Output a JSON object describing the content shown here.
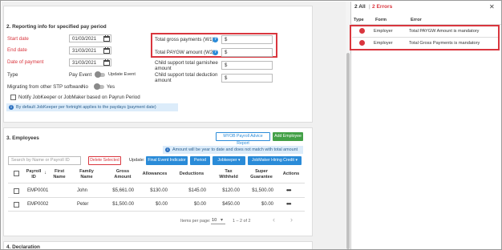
{
  "reporting": {
    "title": "2. Reporting info for specified pay period",
    "start_date_label": "Start date",
    "start_date_value": "01/03/2021",
    "end_date_label": "End date",
    "end_date_value": "31/03/2021",
    "date_of_payment_label": "Date of payment",
    "date_of_payment_value": "31/03/2021",
    "type_label": "Type",
    "type_value": "Pay Event",
    "update_event_label": "Update Event",
    "migrating_label": "Migrating from other STP software",
    "migrating_no": "No",
    "migrating_yes": "Yes",
    "notify_label": "Notify JobKeeper or JobMaker based on Payrun Period",
    "info_text": "By default JobKeeper per fortnight applies to the paydays (payment date)",
    "gross_label": "Total gross payments (W1)",
    "paygw_label": "Total PAYGW amount (W2)",
    "garnishee_label_1": "Child support total garnishee",
    "garnishee_label_2": "amount",
    "deduction_label_1": "Child support total deduction",
    "deduction_label_2": "amount",
    "currency_symbol": "$",
    "help_glyph": "?"
  },
  "employees": {
    "title": "3. Employees",
    "advice_btn": "MYOB Payroll Advice Report",
    "add_btn": "Add Employee",
    "banner": "Amount will be year to date and does not match with total amount",
    "search_placeholder": "Search by Name or Payroll ID",
    "delete_btn": "Delete Selected",
    "update_label": "Update:",
    "final_event_btn": "Final Event Indicator",
    "period_btn": "Period",
    "jobkeeper_btn": "Jobkeeper",
    "jobmaker_btn": "JobMaker Hiring Credit",
    "columns": [
      {
        "l1": "Payroll",
        "l2": "ID"
      },
      {
        "l1": "First",
        "l2": "Name"
      },
      {
        "l1": "Family",
        "l2": "Name"
      },
      {
        "l1": "Gross",
        "l2": "Amount"
      },
      {
        "l1": "Allowances",
        "l2": ""
      },
      {
        "l1": "Deductions",
        "l2": ""
      },
      {
        "l1": "Tax",
        "l2": "Withheld"
      },
      {
        "l1": "Super",
        "l2": "Guarantee"
      },
      {
        "l1": "Actions",
        "l2": ""
      }
    ],
    "rows": [
      {
        "id": "EMP0001",
        "first": "John",
        "family": "",
        "gross": "$5,661.00",
        "allow": "$130.00",
        "deduct": "$145.00",
        "tax": "$120.00",
        "super": "$1,500.00"
      },
      {
        "id": "EMP0002",
        "first": "Peter",
        "family": "",
        "gross": "$1,500.00",
        "allow": "$0.00",
        "deduct": "$0.00",
        "tax": "$450.00",
        "super": "$0.00"
      }
    ],
    "actions_glyph": "•••",
    "items_per_page_label": "Items per page:",
    "items_per_page_value": "10",
    "range_text": "1 – 2 of 2"
  },
  "declaration": {
    "title": "4. Declaration"
  },
  "error_panel": {
    "all_tab": "2 All",
    "errors_tab": "2 Errors",
    "separator": "|",
    "close_glyph": "✕",
    "col_type": "Type",
    "col_form": "Form",
    "col_error": "Error",
    "rows": [
      {
        "form": "Employer",
        "error": "Total PAYGW Amount is mandatory"
      },
      {
        "form": "Employer",
        "error": "Total Gross Payments is mandatory"
      }
    ]
  },
  "colors": {
    "accent": "#2a8bd8",
    "error": "#d9363e",
    "success": "#43a047"
  }
}
